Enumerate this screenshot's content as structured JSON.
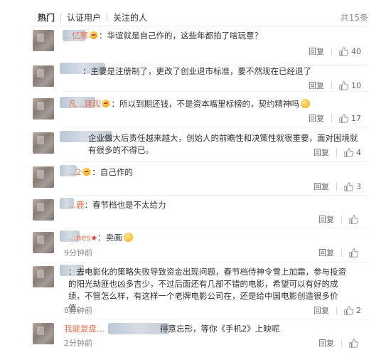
{
  "tabs": [
    {
      "label": "热门",
      "active": true
    },
    {
      "label": "认证用户",
      "active": false
    },
    {
      "label": "关注的人",
      "active": false
    }
  ],
  "total": "共15条",
  "reply_label": "回复",
  "comments": [
    {
      "username": "...忆寒",
      "text": "：华谊就是自己作的，这些年都拍了啥玩意？",
      "time": "",
      "likes": "40"
    },
    {
      "username": "",
      "text": "：主要是注册制了，更改了创业退市标准，要不然现在已经退了",
      "time": "",
      "likes": "10"
    },
    {
      "username": "凡...建观",
      "text": "：所以到期还钱，不是资本嘴里标榜的，契约精神吗",
      "time": "",
      "likes": "17"
    },
    {
      "username": "",
      "text": "企业做大后责任越来越大，创始人的前瞻性和决策性就很重要，面对困境就有很多的不得已。",
      "time": "",
      "likes": "4"
    },
    {
      "username": "...2",
      "text": "：自己作的",
      "time": "",
      "likes": "3"
    },
    {
      "username": "...鹿",
      "text": "：春节档也是不太给力",
      "time": "",
      "likes": ""
    },
    {
      "username": "...nes",
      "text": "：卖画",
      "time": "9分钟前",
      "likes": ""
    },
    {
      "username": "",
      "text": "：去电影化的策略失败导致资金出现问题，春节档侍神令雪上加霜，参与投资的阳光劫匪也凶多吉少，不过后面还有几部不错的电影，希望可以有好的成绩，不管怎么样，有这样一个老牌电影公司在，还是给中国电影创造很多价值。",
      "time": "8分钟前",
      "likes": "2"
    },
    {
      "username": "我能复盘...",
      "text": "得意忘形，等你《手机2》上映呢",
      "time": "2分钟前",
      "likes": ""
    }
  ]
}
